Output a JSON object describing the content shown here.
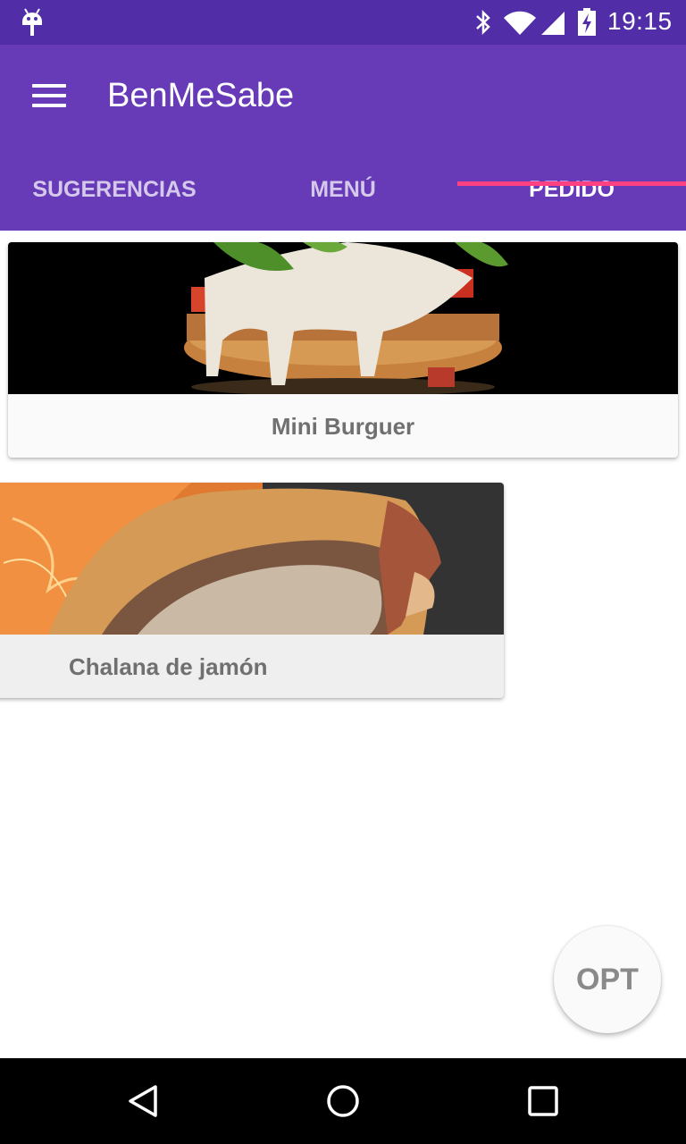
{
  "status_bar": {
    "time": "19:15",
    "icons": [
      "android-icon",
      "bluetooth-icon",
      "wifi-icon",
      "signal-icon",
      "battery-charging-icon"
    ]
  },
  "app_bar": {
    "title": "BenMeSabe",
    "menu_icon": "menu-icon",
    "background": "#673ab7",
    "status_background": "#512da8"
  },
  "tabs": [
    {
      "label": "SUGERENCIAS",
      "active": false
    },
    {
      "label": "MENÚ",
      "active": false
    },
    {
      "label": "PEDIDO",
      "active": true
    }
  ],
  "tab_indicator_color": "#ff4081",
  "cards": [
    {
      "title": "Mini Burguer"
    },
    {
      "title": "Chalana de jamón"
    }
  ],
  "fab": {
    "label": "OPT"
  },
  "nav_bar": {
    "icons": [
      "back-icon",
      "home-icon",
      "recents-icon"
    ]
  }
}
